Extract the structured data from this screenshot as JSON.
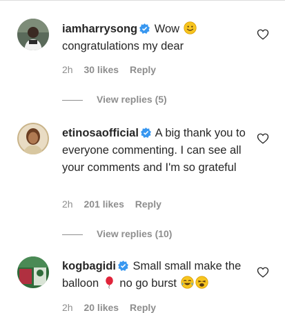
{
  "comments": [
    {
      "username": "iamharrysong",
      "text_before_emoji": "Wow",
      "text_after": "congratulations my dear",
      "time": "2h",
      "likes": "30 likes",
      "reply": "Reply",
      "view_replies": "View replies (5)"
    },
    {
      "username": "etinosaofficial",
      "text": "A big thank you to everyone commenting. I can see all your comments and I'm so grateful",
      "time": "2h",
      "likes": "201 likes",
      "reply": "Reply",
      "view_replies": "View replies (10)"
    },
    {
      "username": "kogbagidi",
      "text_part1": "Small small make the balloon",
      "text_part2": "no go burst",
      "time": "2h",
      "likes": "20 likes",
      "reply": "Reply"
    }
  ],
  "colors": {
    "verified_blue": "#3897f0",
    "meta_gray": "#8e8e8e",
    "text": "#262626"
  },
  "icons": [
    "verified-badge-icon",
    "heart-icon",
    "smiley-emoji-icon",
    "balloon-emoji-icon",
    "tears-of-joy-emoji-icon",
    "weary-emoji-icon"
  ]
}
